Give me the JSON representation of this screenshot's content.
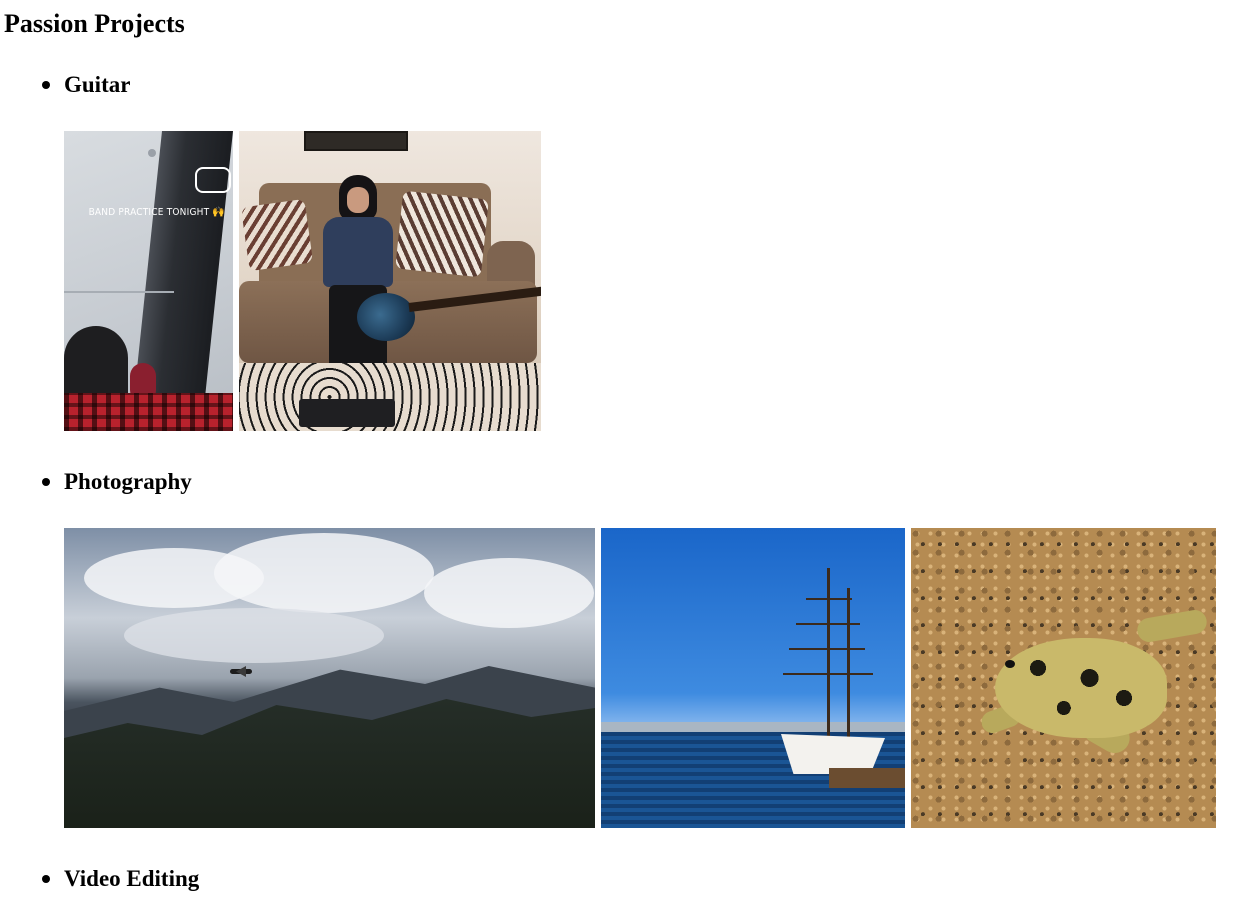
{
  "page": {
    "title": "Passion Projects"
  },
  "sections": [
    {
      "label": "Guitar",
      "photos": [
        {
          "caption": "BAND PRACTICE TONIGHT 🙌"
        },
        {
          "caption": ""
        }
      ]
    },
    {
      "label": "Photography",
      "photos": [
        {
          "caption": ""
        },
        {
          "caption": ""
        },
        {
          "caption": ""
        }
      ]
    },
    {
      "label": "Video Editing"
    }
  ]
}
